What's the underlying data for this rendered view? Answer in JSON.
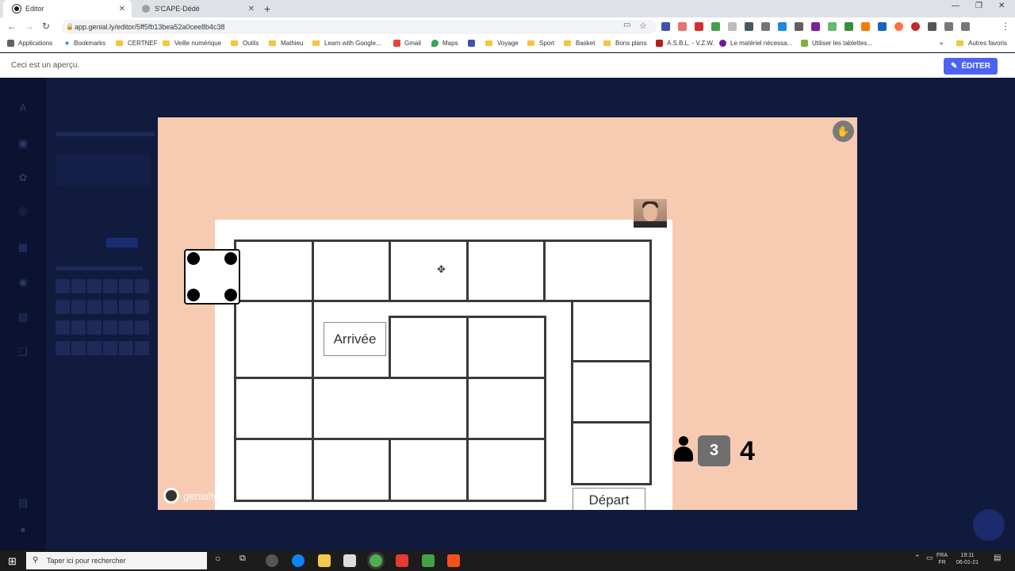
{
  "browser": {
    "tabs": [
      {
        "title": "Editor",
        "active": true
      },
      {
        "title": "S'CAPE-Dédé",
        "active": false
      }
    ],
    "new_tab_label": "+",
    "url": "app.genial.ly/editor/5ff5fb13bea52a0cee8b4c38",
    "profile_initial": "M",
    "bookmarks": [
      {
        "label": "Applications",
        "icon": "apps-grid-icon"
      },
      {
        "label": "Bookmarks",
        "icon": "star-icon"
      },
      {
        "label": "CERTNEF",
        "icon": "folder-icon"
      },
      {
        "label": "Veille numérique",
        "icon": "folder-icon"
      },
      {
        "label": "Outils",
        "icon": "folder-icon"
      },
      {
        "label": "Mathieu",
        "icon": "folder-icon"
      },
      {
        "label": "Learn with Google...",
        "icon": "folder-icon"
      },
      {
        "label": "Gmail",
        "icon": "gmail-icon"
      },
      {
        "label": "Maps",
        "icon": "maps-icon"
      },
      {
        "label": "Voyage",
        "icon": "folder-icon"
      },
      {
        "label": "Sport",
        "icon": "folder-icon"
      },
      {
        "label": "Basket",
        "icon": "folder-icon"
      },
      {
        "label": "Bons plans",
        "icon": "folder-icon"
      },
      {
        "label": "A.S.B.L. - V.Z.W.",
        "icon": "site-icon"
      },
      {
        "label": "Le matériel nécessa...",
        "icon": "site-icon"
      },
      {
        "label": "Utiliser les tablettes...",
        "icon": "site-icon"
      }
    ],
    "other_bookmarks": "Autres favoris"
  },
  "preview": {
    "notice": "Ceci est un aperçu.",
    "edit_label": "ÉDITER"
  },
  "game": {
    "arrival_label": "Arrivée",
    "departure_label": "Départ",
    "die_value": 4,
    "counter_value": "3",
    "score_value": "4",
    "brand": "genially",
    "canvas_color": "#f7cbb1"
  },
  "taskbar": {
    "search_placeholder": "Taper ici pour rechercher",
    "lang_top": "FRA",
    "lang_bottom": "FR",
    "time": "19:11",
    "date": "06-01-21"
  }
}
